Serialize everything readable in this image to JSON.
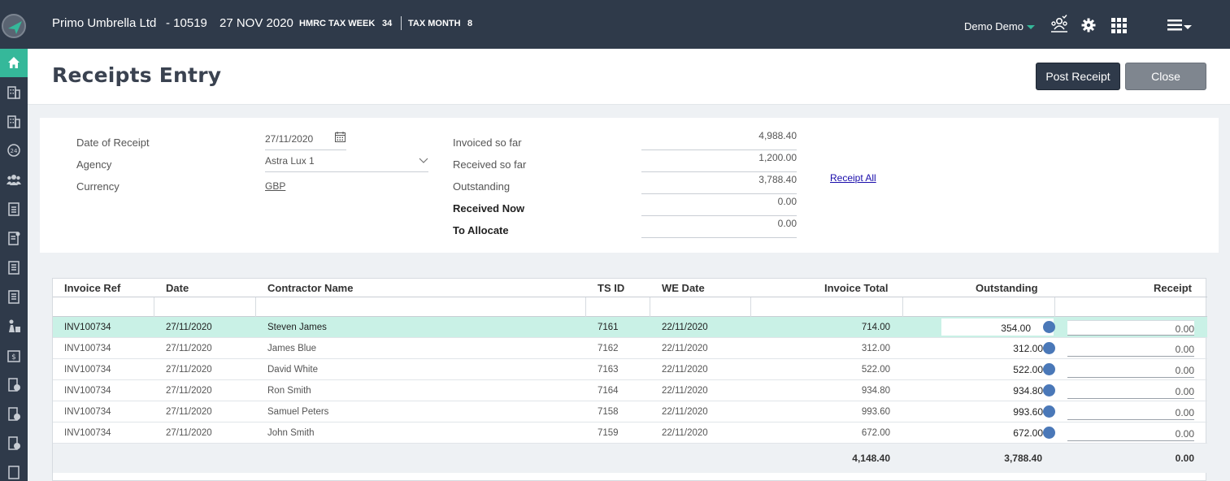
{
  "header": {
    "company": "Primo Umbrella Ltd",
    "code": "- 10519",
    "date": "27 NOV 2020",
    "tax_week_label": "HMRC TAX WEEK",
    "tax_week_value": "34",
    "tax_month_label": "TAX MONTH",
    "tax_month_value": "8",
    "user": "Demo Demo"
  },
  "page": {
    "title": "Receipts Entry",
    "post_label": "Post Receipt",
    "close_label": "Close"
  },
  "form": {
    "date_label": "Date of Receipt",
    "date_value": "27/11/2020",
    "agency_label": "Agency",
    "agency_value": "Astra Lux 1",
    "currency_label": "Currency",
    "currency_value": "GBP",
    "invoiced_label": "Invoiced so far",
    "invoiced_value": "4,988.40",
    "received_label": "Received so far",
    "received_value": "1,200.00",
    "outstanding_label": "Outstanding",
    "outstanding_value": "3,788.40",
    "received_now_label": "Received Now",
    "received_now_value": "0.00",
    "to_allocate_label": "To Allocate",
    "to_allocate_value": "0.00",
    "receipt_all_label": "Receipt All"
  },
  "table": {
    "columns": [
      "Invoice Ref",
      "Date",
      "Contractor Name",
      "TS ID",
      "WE Date",
      "Invoice Total",
      "Outstanding",
      "Receipt"
    ],
    "rows": [
      {
        "ref": "INV100734",
        "date": "27/11/2020",
        "name": "Steven James",
        "tsid": "7161",
        "we": "22/11/2020",
        "total": "714.00",
        "outstanding": "354.00",
        "receipt": "0.00"
      },
      {
        "ref": "INV100734",
        "date": "27/11/2020",
        "name": "James Blue",
        "tsid": "7162",
        "we": "22/11/2020",
        "total": "312.00",
        "outstanding": "312.00",
        "receipt": "0.00"
      },
      {
        "ref": "INV100734",
        "date": "27/11/2020",
        "name": "David White",
        "tsid": "7163",
        "we": "22/11/2020",
        "total": "522.00",
        "outstanding": "522.00",
        "receipt": "0.00"
      },
      {
        "ref": "INV100734",
        "date": "27/11/2020",
        "name": "Ron Smith",
        "tsid": "7164",
        "we": "22/11/2020",
        "total": "934.80",
        "outstanding": "934.80",
        "receipt": "0.00"
      },
      {
        "ref": "INV100734",
        "date": "27/11/2020",
        "name": "Samuel Peters",
        "tsid": "7158",
        "we": "22/11/2020",
        "total": "993.60",
        "outstanding": "993.60",
        "receipt": "0.00"
      },
      {
        "ref": "INV100734",
        "date": "27/11/2020",
        "name": "John Smith",
        "tsid": "7159",
        "we": "22/11/2020",
        "total": "672.00",
        "outstanding": "672.00",
        "receipt": "0.00"
      }
    ],
    "totals": {
      "total": "4,148.40",
      "outstanding": "3,788.40",
      "receipt": "0.00"
    }
  },
  "colors": {
    "topbar": "#2f3a4a",
    "accent": "#35b89a",
    "selected_row": "#c9f1e6"
  },
  "icons": [
    "logo-icon",
    "home-icon",
    "building-icon",
    "support-icon",
    "users-icon",
    "checklist-icon",
    "document-icon",
    "coins-icon",
    "team-icon",
    "gear-icon",
    "grid-icon",
    "menu-icon",
    "calendar-icon",
    "chevron-down-icon",
    "info-icon"
  ]
}
